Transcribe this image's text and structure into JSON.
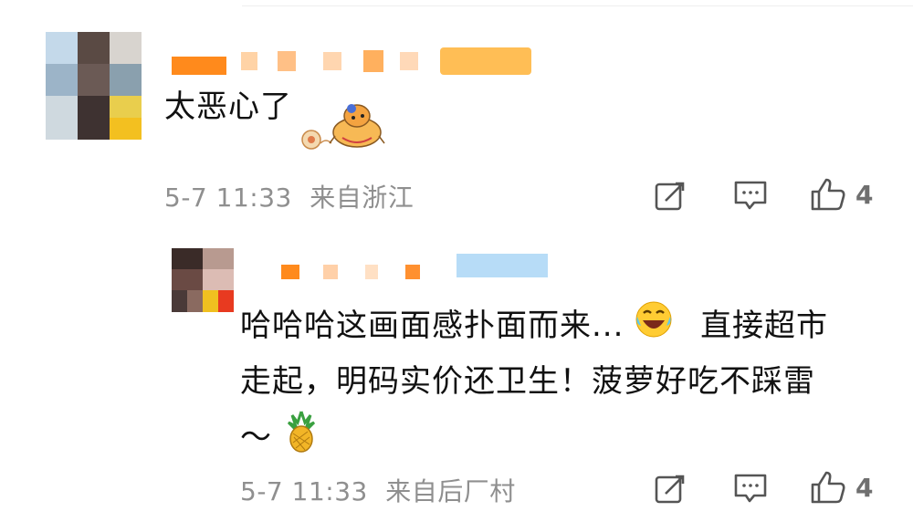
{
  "comments": [
    {
      "text": "太恶心了",
      "time": "5-7 11:33",
      "location": "来自浙江",
      "likes": "4",
      "icons": [
        "sticker-icon",
        "repost-icon",
        "comment-icon",
        "like-icon"
      ]
    }
  ],
  "reply": {
    "line1": "哈哈哈这画面感扑面而来...",
    "line1b": "直接超市",
    "line2": "走起，明码实价还卫生！菠萝好吃不踩雷",
    "line3": "～",
    "time": "5-7 11:33",
    "location": "来自后厂村",
    "likes": "4",
    "icons": [
      "laugh-emoji-icon",
      "pineapple-emoji-icon",
      "repost-icon",
      "comment-icon",
      "like-icon"
    ]
  },
  "colors": {
    "accent_orange": "#ff8200",
    "meta_gray": "#8f8f8f",
    "blur_blue": "#a9d3f5"
  }
}
